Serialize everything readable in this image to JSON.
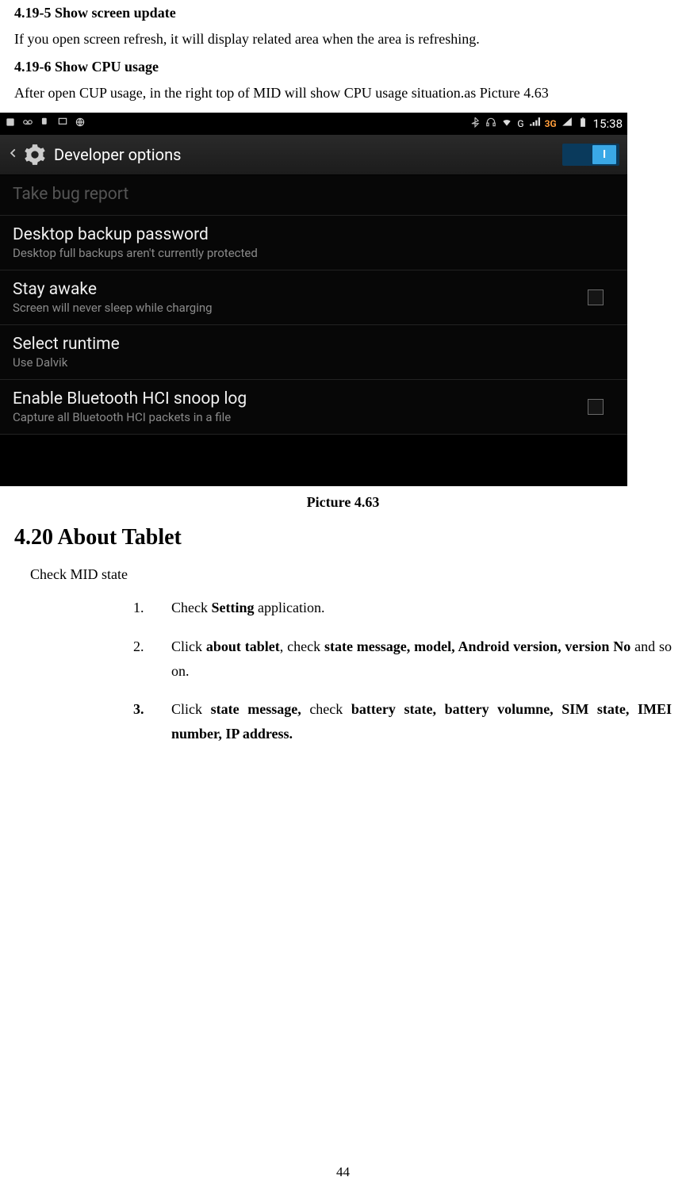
{
  "doc": {
    "h1a": "4.19-5 Show screen update",
    "p1": "If you open screen refresh, it will display related area when the area is refreshing.",
    "h1b": "4.19-6 Show CPU usage",
    "p2": "After open CUP usage, in the right top of MID will show CPU usage situation.as Picture 4.63",
    "caption": "Picture 4.63",
    "h2": "4.20 About Tablet",
    "check_state": "Check MID state",
    "li1_num": "1.",
    "li1_a": "Check ",
    "li1_b": "Setting",
    "li1_c": " application.",
    "li2_num": "2.",
    "li2_a": "Click ",
    "li2_b": "about tablet",
    "li2_c": ", check ",
    "li2_d": "state message, model, Android version, version No",
    "li2_e": " and so on.",
    "li3_num": "3.",
    "li3_a": "Click ",
    "li3_b": "state message,",
    "li3_c": " check ",
    "li3_d": "battery state, battery volumne, SIM state, IMEI number, IP address.",
    "page_num": "44"
  },
  "shot": {
    "status": {
      "time": "15:38",
      "threeg": "3G",
      "g": "G"
    },
    "header": {
      "title": "Developer options",
      "toggle_state": "I"
    },
    "items": [
      {
        "title": "Take bug report",
        "sub": "",
        "disabled": true,
        "checkbox": false
      },
      {
        "title": "Desktop backup password",
        "sub": "Desktop full backups aren't currently protected",
        "disabled": false,
        "checkbox": false
      },
      {
        "title": "Stay awake",
        "sub": "Screen will never sleep while charging",
        "disabled": false,
        "checkbox": true
      },
      {
        "title": "Select runtime",
        "sub": "Use Dalvik",
        "disabled": false,
        "checkbox": false
      },
      {
        "title": "Enable Bluetooth HCI snoop log",
        "sub": "Capture all Bluetooth HCI packets in a file",
        "disabled": false,
        "checkbox": true
      }
    ]
  }
}
